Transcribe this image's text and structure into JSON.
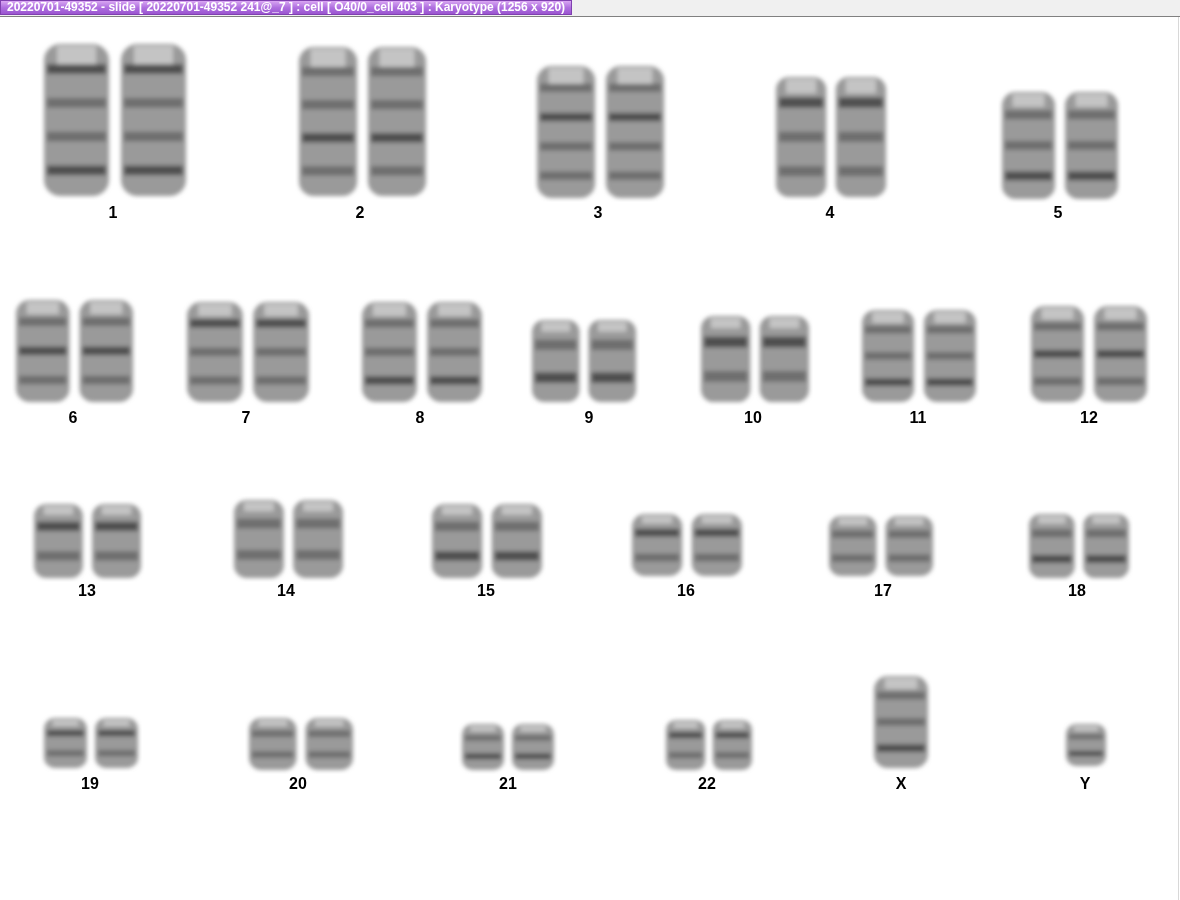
{
  "window": {
    "title": "20220701-49352 - slide [ 20220701-49352 241@_7 ] : cell [ O40/0_cell 403 ] : Karyotype  (1256 x 920)"
  },
  "karyotype": [
    {
      "label": "1",
      "kind": "pair"
    },
    {
      "label": "2",
      "kind": "pair"
    },
    {
      "label": "3",
      "kind": "pair"
    },
    {
      "label": "4",
      "kind": "pair"
    },
    {
      "label": "5",
      "kind": "pair"
    },
    {
      "label": "6",
      "kind": "pair"
    },
    {
      "label": "7",
      "kind": "pair"
    },
    {
      "label": "8",
      "kind": "pair"
    },
    {
      "label": "9",
      "kind": "pair"
    },
    {
      "label": "10",
      "kind": "pair"
    },
    {
      "label": "11",
      "kind": "pair"
    },
    {
      "label": "12",
      "kind": "pair"
    },
    {
      "label": "13",
      "kind": "pair"
    },
    {
      "label": "14",
      "kind": "pair"
    },
    {
      "label": "15",
      "kind": "pair"
    },
    {
      "label": "16",
      "kind": "pair"
    },
    {
      "label": "17",
      "kind": "pair"
    },
    {
      "label": "18",
      "kind": "pair"
    },
    {
      "label": "19",
      "kind": "pair"
    },
    {
      "label": "20",
      "kind": "pair"
    },
    {
      "label": "21",
      "kind": "pair"
    },
    {
      "label": "22",
      "kind": "pair"
    },
    {
      "label": "X",
      "kind": "single"
    },
    {
      "label": "Y",
      "kind": "single"
    }
  ]
}
